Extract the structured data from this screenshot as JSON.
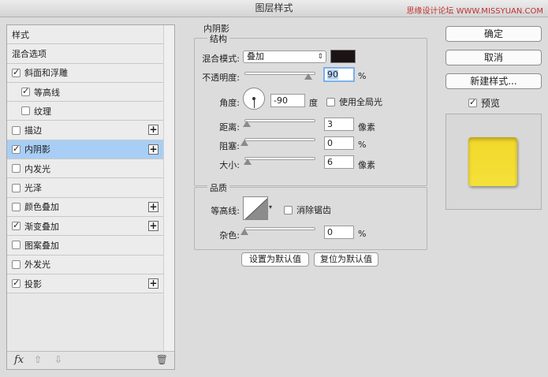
{
  "window": {
    "title": "图层样式",
    "watermark": "思缘设计论坛 WWW.MISSYUAN.COM"
  },
  "sidebar": {
    "items": [
      {
        "label": "样式",
        "checkbox": false,
        "checked": false,
        "sub": false,
        "plus": false,
        "selected": false
      },
      {
        "label": "混合选项",
        "checkbox": false,
        "checked": false,
        "sub": false,
        "plus": false,
        "selected": false
      },
      {
        "label": "斜面和浮雕",
        "checkbox": true,
        "checked": true,
        "sub": false,
        "plus": false,
        "selected": false
      },
      {
        "label": "等高线",
        "checkbox": true,
        "checked": true,
        "sub": true,
        "plus": false,
        "selected": false
      },
      {
        "label": "纹理",
        "checkbox": true,
        "checked": false,
        "sub": true,
        "plus": false,
        "selected": false
      },
      {
        "label": "描边",
        "checkbox": true,
        "checked": false,
        "sub": false,
        "plus": true,
        "selected": false
      },
      {
        "label": "内阴影",
        "checkbox": true,
        "checked": true,
        "sub": false,
        "plus": true,
        "selected": true
      },
      {
        "label": "内发光",
        "checkbox": true,
        "checked": false,
        "sub": false,
        "plus": false,
        "selected": false
      },
      {
        "label": "光泽",
        "checkbox": true,
        "checked": false,
        "sub": false,
        "plus": false,
        "selected": false
      },
      {
        "label": "颜色叠加",
        "checkbox": true,
        "checked": false,
        "sub": false,
        "plus": true,
        "selected": false
      },
      {
        "label": "渐变叠加",
        "checkbox": true,
        "checked": true,
        "sub": false,
        "plus": true,
        "selected": false
      },
      {
        "label": "图案叠加",
        "checkbox": true,
        "checked": false,
        "sub": false,
        "plus": false,
        "selected": false
      },
      {
        "label": "外发光",
        "checkbox": true,
        "checked": false,
        "sub": false,
        "plus": false,
        "selected": false
      },
      {
        "label": "投影",
        "checkbox": true,
        "checked": true,
        "sub": false,
        "plus": true,
        "selected": false
      }
    ],
    "footer": {
      "fx": "fx",
      "up": "⇧",
      "down": "⇩",
      "trash": "🗑"
    }
  },
  "inner_shadow": {
    "title": "内阴影",
    "structure": {
      "legend": "结构",
      "blend_mode_label": "混合模式:",
      "blend_mode_value": "叠加",
      "shadow_color": "#1c1414",
      "opacity_label": "不透明度:",
      "opacity_value": "90",
      "opacity_unit": "%",
      "opacity_level": 0.9,
      "angle_label": "角度:",
      "angle_value": "-90",
      "angle_unit": "度",
      "global_light_label": "使用全局光",
      "global_light_checked": false,
      "distance_label": "距离:",
      "distance_value": "3",
      "distance_unit": "像素",
      "distance_level": 0.03,
      "choke_label": "阻塞:",
      "choke_value": "0",
      "choke_unit": "%",
      "choke_level": 0,
      "size_label": "大小:",
      "size_value": "6",
      "size_unit": "像素",
      "size_level": 0.04
    },
    "quality": {
      "legend": "品质",
      "contour_label": "等高线:",
      "anti_alias_label": "消除锯齿",
      "anti_alias_checked": false,
      "noise_label": "杂色:",
      "noise_value": "0",
      "noise_unit": "%",
      "noise_level": 0
    },
    "make_default_label": "设置为默认值",
    "reset_default_label": "复位为默认值"
  },
  "actions": {
    "ok_label": "确定",
    "cancel_label": "取消",
    "new_style_label": "新建样式...",
    "preview_label": "预览",
    "preview_checked": true,
    "preview_color": "#f2d82a"
  }
}
